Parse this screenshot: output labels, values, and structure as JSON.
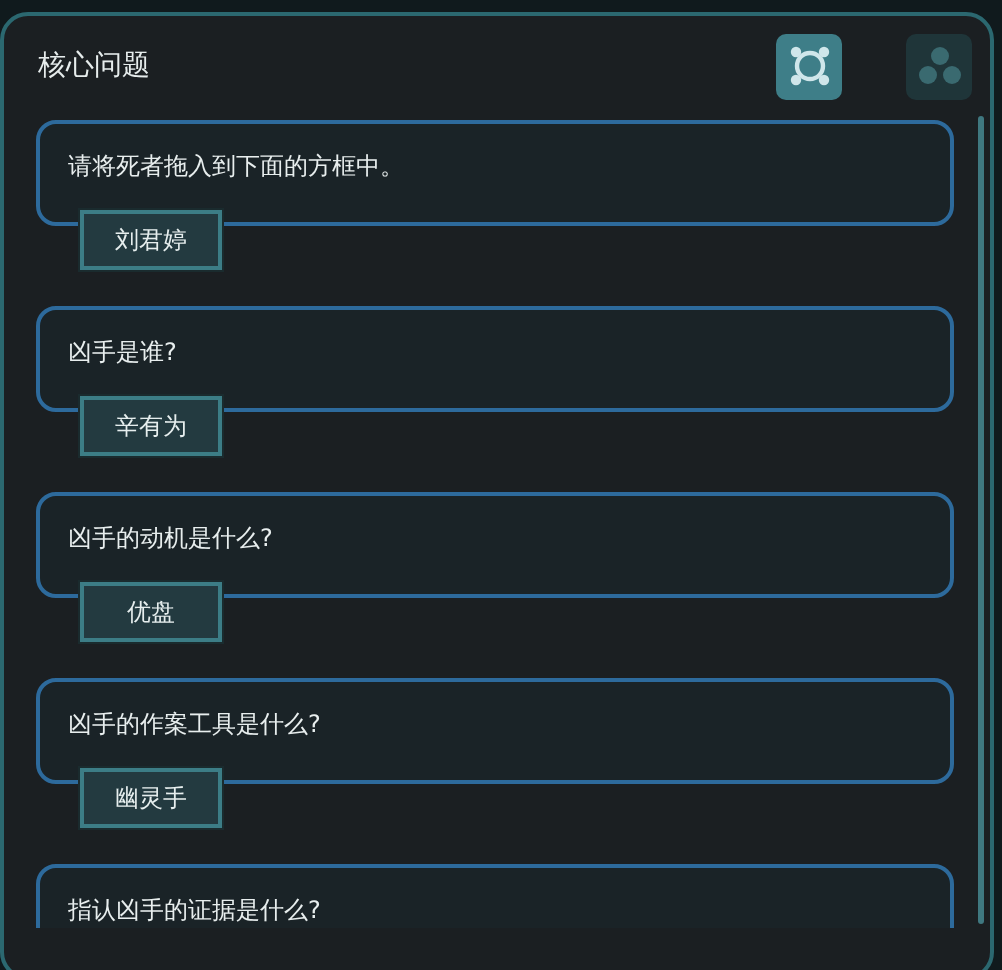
{
  "panel": {
    "title": "核心问题"
  },
  "tabs": [
    {
      "kind": "nodes",
      "selected": true
    },
    {
      "kind": "cluster",
      "selected": false
    }
  ],
  "questions": [
    {
      "question": "请将死者拖入到下面的方框中。",
      "answer": "刘君婷"
    },
    {
      "question": "凶手是谁?",
      "answer": "辛有为"
    },
    {
      "question": "凶手的动机是什么?",
      "answer": "优盘"
    },
    {
      "question": "凶手的作案工具是什么?",
      "answer": "幽灵手"
    },
    {
      "question": "指认凶手的证据是什么?"
    }
  ]
}
